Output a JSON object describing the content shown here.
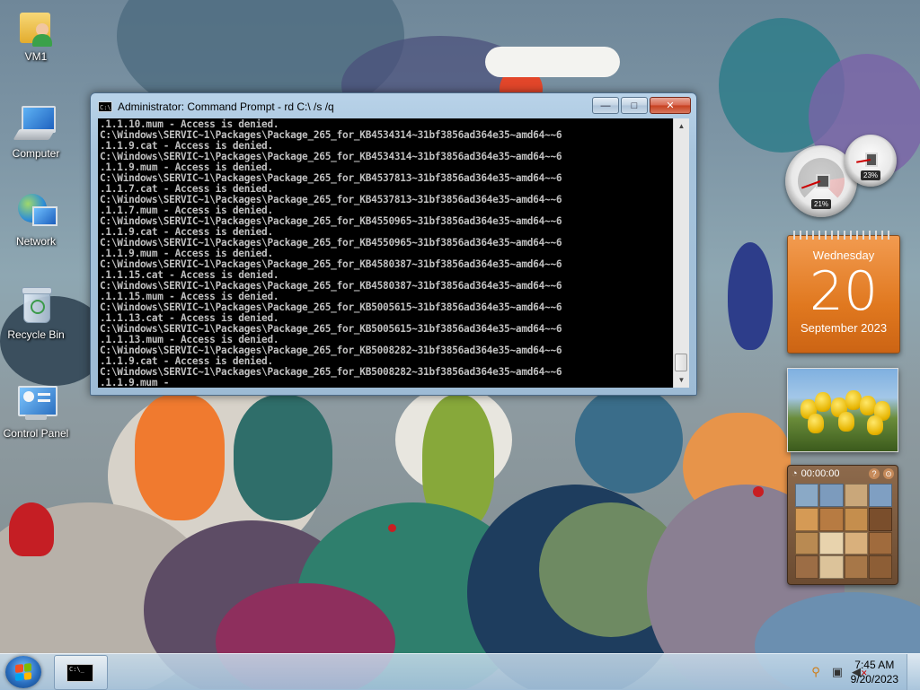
{
  "desktop": {
    "icons": [
      {
        "label": "VM1"
      },
      {
        "label": "Computer"
      },
      {
        "label": "Network"
      },
      {
        "label": "Recycle Bin"
      },
      {
        "label": "Control Panel"
      }
    ]
  },
  "cmd_window": {
    "title": "Administrator:  Command Prompt - rd  C:\\ /s /q",
    "buttons": {
      "minimize": "—",
      "maximize": "□",
      "close": "✕"
    },
    "console_lines": [
      ".1.1.10.mum - Access is denied.",
      "C:\\Windows\\SERVIC~1\\Packages\\Package_265_for_KB4534314~31bf3856ad364e35~amd64~~6",
      ".1.1.9.cat - Access is denied.",
      "C:\\Windows\\SERVIC~1\\Packages\\Package_265_for_KB4534314~31bf3856ad364e35~amd64~~6",
      ".1.1.9.mum - Access is denied.",
      "C:\\Windows\\SERVIC~1\\Packages\\Package_265_for_KB4537813~31bf3856ad364e35~amd64~~6",
      ".1.1.7.cat - Access is denied.",
      "C:\\Windows\\SERVIC~1\\Packages\\Package_265_for_KB4537813~31bf3856ad364e35~amd64~~6",
      ".1.1.7.mum - Access is denied.",
      "C:\\Windows\\SERVIC~1\\Packages\\Package_265_for_KB4550965~31bf3856ad364e35~amd64~~6",
      ".1.1.9.cat - Access is denied.",
      "C:\\Windows\\SERVIC~1\\Packages\\Package_265_for_KB4550965~31bf3856ad364e35~amd64~~6",
      ".1.1.9.mum - Access is denied.",
      "C:\\Windows\\SERVIC~1\\Packages\\Package_265_for_KB4580387~31bf3856ad364e35~amd64~~6",
      ".1.1.15.cat - Access is denied.",
      "C:\\Windows\\SERVIC~1\\Packages\\Package_265_for_KB4580387~31bf3856ad364e35~amd64~~6",
      ".1.1.15.mum - Access is denied.",
      "C:\\Windows\\SERVIC~1\\Packages\\Package_265_for_KB5005615~31bf3856ad364e35~amd64~~6",
      ".1.1.13.cat - Access is denied.",
      "C:\\Windows\\SERVIC~1\\Packages\\Package_265_for_KB5005615~31bf3856ad364e35~amd64~~6",
      ".1.1.13.mum - Access is denied.",
      "C:\\Windows\\SERVIC~1\\Packages\\Package_265_for_KB5008282~31bf3856ad364e35~amd64~~6",
      ".1.1.9.cat - Access is denied.",
      "C:\\Windows\\SERVIC~1\\Packages\\Package_265_for_KB5008282~31bf3856ad364e35~amd64~~6",
      ".1.1.9.mum -"
    ],
    "console_colors": {
      "background": "#000000",
      "text": "#c0c0c0"
    }
  },
  "gadgets": {
    "cpu_meter": {
      "cpu": "21%",
      "memory": "23%"
    },
    "calendar": {
      "weekday": "Wednesday",
      "day": "20",
      "month_year": "September 2023"
    },
    "slideshow": {},
    "puzzle": {
      "timer": "00:00:00",
      "help": "?"
    }
  },
  "taskbar": {
    "tray_icons": [
      "search-icon",
      "network-icon",
      "volume-muted-icon"
    ],
    "clock": {
      "time": "7:45 AM",
      "date": "9/20/2023"
    }
  },
  "colors": {
    "close_button": "#c6401f",
    "calendar": "#e0781f",
    "taskbar": "#a5c3dc"
  }
}
